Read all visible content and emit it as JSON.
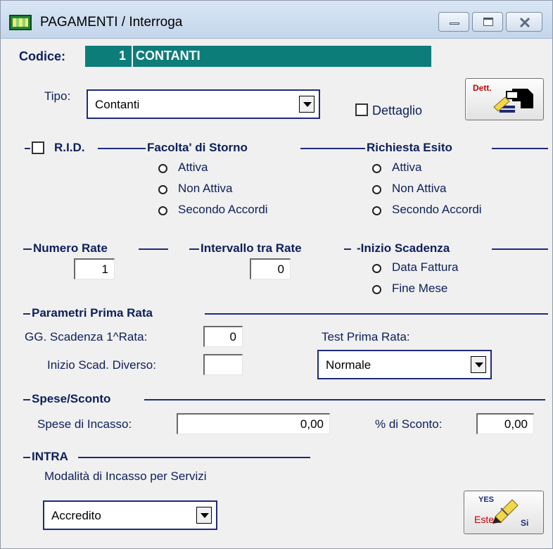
{
  "window": {
    "title": "PAGAMENTI / Interroga",
    "controls": {
      "minimize": "minimize-icon",
      "maximize": "maximize-icon",
      "close": "close-icon"
    }
  },
  "codice": {
    "label": "Codice:",
    "number": "1",
    "description": "CONTANTI"
  },
  "tipo": {
    "label": "Tipo:",
    "value": "Contanti"
  },
  "dettaglio": {
    "label": "Dettaglio",
    "checked": false,
    "button_label": "Dett."
  },
  "rid": {
    "label": "R.I.D.",
    "checked": false
  },
  "facolta_storno": {
    "label": "Facolta' di Storno",
    "options": [
      "Attiva",
      "Non Attiva",
      "Secondo Accordi"
    ]
  },
  "richiesta_esito": {
    "label": "Richiesta Esito",
    "options": [
      "Attiva",
      "Non Attiva",
      "Secondo Accordi"
    ]
  },
  "numero_rate": {
    "label": "Numero Rate",
    "value": "1"
  },
  "intervallo_rate": {
    "label": "Intervallo tra Rate",
    "value": "0"
  },
  "inizio_scadenza": {
    "label": "-Inizio Scadenza",
    "options": [
      "Data Fattura",
      "Fine Mese"
    ]
  },
  "parametri_prima_rata": {
    "label": "Parametri Prima Rata",
    "gg_scadenza_label": "GG. Scadenza 1^Rata:",
    "gg_scadenza_value": "0",
    "inizio_scad_diverso_label": "Inizio Scad. Diverso:",
    "inizio_scad_diverso_value": "",
    "test_prima_rata_label": "Test Prima Rata:",
    "test_prima_rata_value": "Normale"
  },
  "spese_sconto": {
    "label": "Spese/Sconto",
    "spese_incasso_label": "Spese di Incasso:",
    "spese_incasso_value": "0,00",
    "sconto_label": "% di Sconto:",
    "sconto_value": "0,00"
  },
  "intra": {
    "label": "INTRA",
    "modalita_label": "Modalità di Incasso per Servizi",
    "modalita_value": "Accredito"
  },
  "estero_button": {
    "top_label": "YES",
    "main_label": "Estero",
    "suffix": "Si"
  },
  "colors": {
    "teal": "#0d7d7a",
    "navy": "#0d1f5c",
    "bg": "#f0f0f0"
  }
}
